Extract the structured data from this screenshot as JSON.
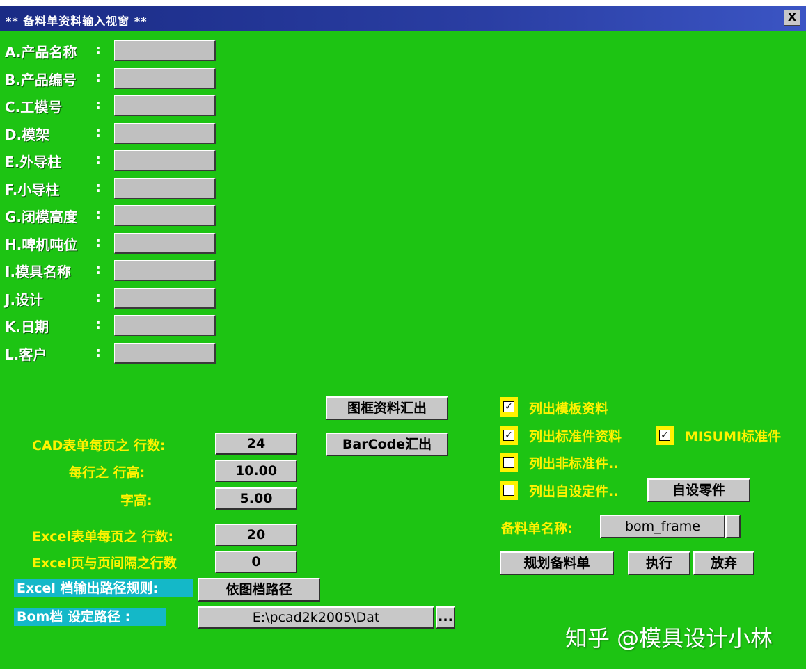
{
  "window": {
    "title": "** 备料单资料输入视窗 **",
    "close_label": "X"
  },
  "fields": [
    {
      "label": "A.产品名称",
      "value": ""
    },
    {
      "label": "B.产品编号",
      "value": ""
    },
    {
      "label": "C.工模号",
      "value": ""
    },
    {
      "label": "D.模架",
      "value": ""
    },
    {
      "label": "E.外导柱",
      "value": ""
    },
    {
      "label": "F.小导柱",
      "value": ""
    },
    {
      "label": "G.闭模高度",
      "value": ""
    },
    {
      "label": "H.啤机吨位",
      "value": ""
    },
    {
      "label": "I.模具名称",
      "value": ""
    },
    {
      "label": "J.设计",
      "value": ""
    },
    {
      "label": "K.日期",
      "value": ""
    },
    {
      "label": "L.客户",
      "value": ""
    }
  ],
  "colon": ":",
  "buttons": {
    "frame_export": "图框资料汇出",
    "barcode_export": "BarCode汇出",
    "custom_parts": "自设零件",
    "plan_bom": "规划备料单",
    "execute": "执行",
    "cancel": "放弃",
    "follow_path": "依图档路径",
    "browse": "..."
  },
  "settings": {
    "cad_rows_label": "CAD表单每页之 行数:",
    "cad_rows_value": "24",
    "row_height_label": "每行之 行高:",
    "row_height_value": "10.00",
    "char_height_label": "字高:",
    "char_height_value": "5.00",
    "excel_rows_label": "Excel表单每页之 行数:",
    "excel_rows_value": "20",
    "excel_gap_label": "Excel页与页间隔之行数",
    "excel_gap_value": "0",
    "excel_path_rule_label": "Excel 档输出路径规则:",
    "bom_path_label": "Bom档 设定路径 :",
    "bom_path_value": "E:\\pcad2k2005\\Dat"
  },
  "options": [
    {
      "label": "列出模板资料",
      "checked": true
    },
    {
      "label": "列出标准件资料",
      "checked": true
    },
    {
      "label": "MISUMI标准件",
      "checked": true
    },
    {
      "label": "列出非标准件..",
      "checked": false
    },
    {
      "label": "列出自设定件..",
      "checked": false
    }
  ],
  "bom_name": {
    "label": "备料单名称:",
    "value": "bom_frame"
  },
  "watermark": "知乎 @模具设计小林",
  "colors": {
    "background": "#1dc413",
    "label_yellow": "#fff200",
    "cyan_label": "#14b8c8",
    "title_bar": "#1a2b85"
  }
}
